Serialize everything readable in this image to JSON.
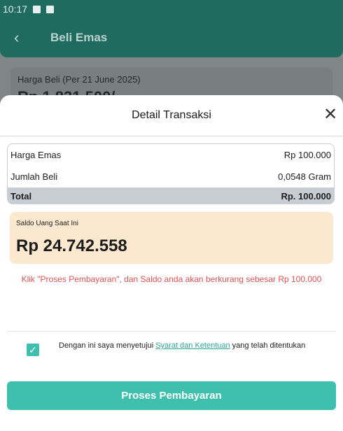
{
  "status_bar": {
    "time": "10:17"
  },
  "app_bar": {
    "title": "Beli Emas",
    "back_icon": "back-arrow-icon"
  },
  "background_card": {
    "label": "Harga Beli (Per 21 June 2025)",
    "value": "Rp 1.831.500/..."
  },
  "sheet": {
    "title": "Detail Transaksi",
    "close_icon": "close-icon",
    "details": [
      {
        "label": "Harga Emas",
        "value": "Rp 100.000"
      },
      {
        "label": "Jumlah Beli",
        "value": "0,0548 Gram"
      }
    ],
    "total": {
      "label": "Total",
      "value": "Rp. 100.000"
    },
    "saldo": {
      "label": "Saldo Uang Saat Ini",
      "value": "Rp 24.742.558"
    },
    "warning": "Klik \"Proses Pembayaran\", dan Saldo anda akan berkurang sebesar Rp 100.000",
    "agreement": {
      "checked": true,
      "prefix": "Dengan ini saya menyetujui ",
      "link": "Syarat dan Ketentuan",
      "suffix": " yang telah ditentukan"
    },
    "pay_button": "Proses Pembayaran"
  },
  "colors": {
    "primary": "#3fbfae",
    "header": "#1f6b5f",
    "warning": "#e65050",
    "saldo_bg": "#fbe8cf"
  }
}
